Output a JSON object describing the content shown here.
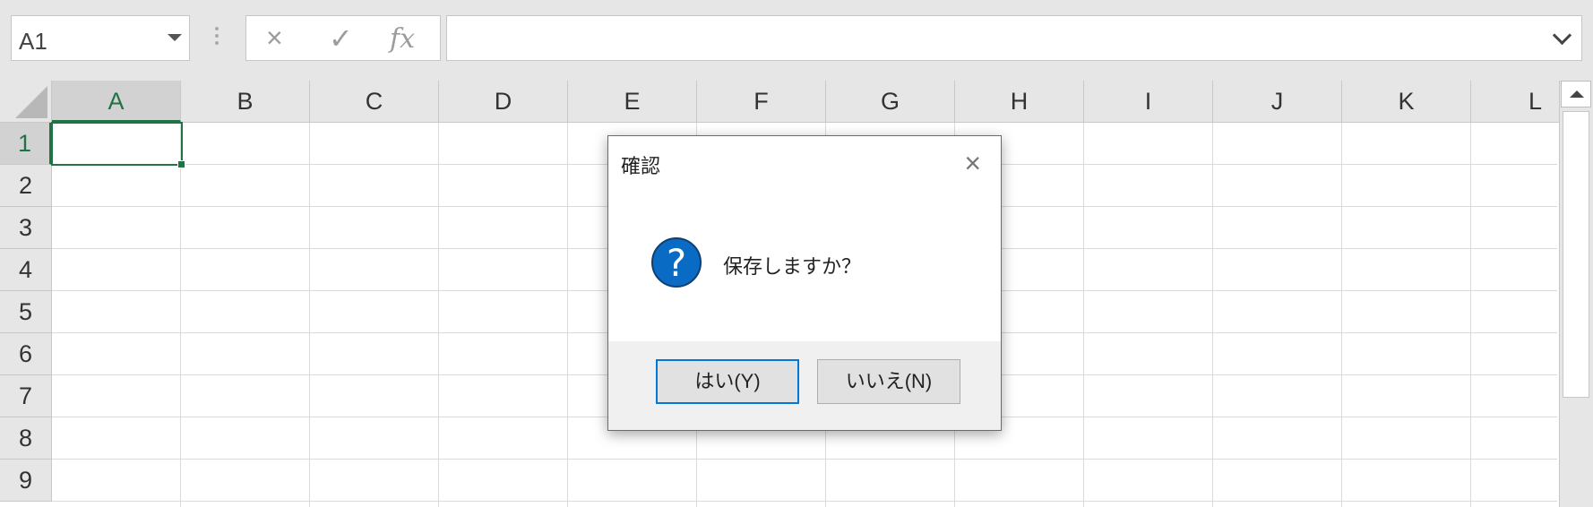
{
  "formula_bar": {
    "name_box_value": "A1",
    "cancel_icon": "×",
    "enter_icon": "✓",
    "fx_icon": "fx",
    "formula_value": ""
  },
  "columns": [
    "A",
    "B",
    "C",
    "D",
    "E",
    "F",
    "G",
    "H",
    "I",
    "J",
    "K",
    "L"
  ],
  "rows": [
    "1",
    "2",
    "3",
    "4",
    "5",
    "6",
    "7",
    "8",
    "9"
  ],
  "selected_cell": "A1",
  "colors": {
    "accent": "#217346",
    "dialog_button_focus": "#0078d7",
    "question_icon": "#0a6bc4"
  },
  "dialog": {
    "title": "確認",
    "close_icon": "×",
    "icon_glyph": "?",
    "message": "保存しますか？",
    "buttons": {
      "yes": "はい(Y)",
      "no": "いいえ(N)"
    }
  }
}
